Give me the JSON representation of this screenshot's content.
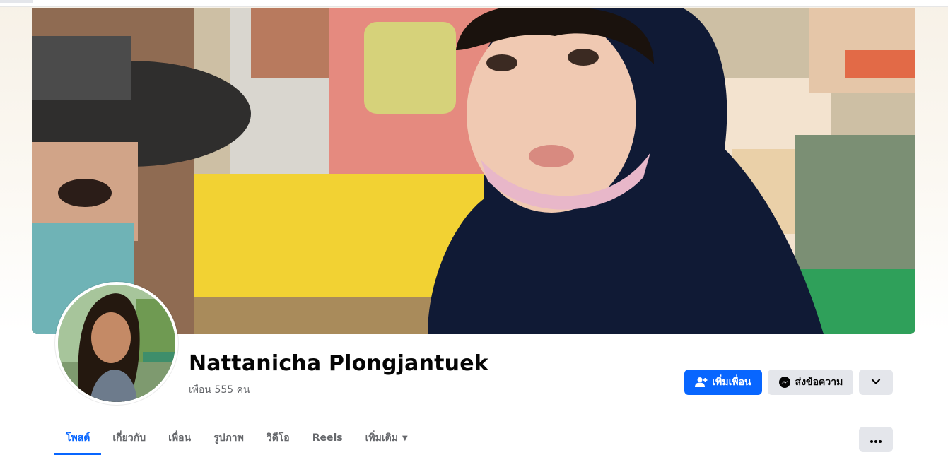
{
  "profile": {
    "name": "Nattanicha Plongjantuek",
    "friends_text": "เพื่อน 555 คน"
  },
  "actions": {
    "add_friend_label": "เพิ่มเพื่อน",
    "message_label": "ส่งข้อความ"
  },
  "tabs": [
    {
      "label": "โพสต์",
      "active": true
    },
    {
      "label": "เกี่ยวกับ",
      "active": false
    },
    {
      "label": "เพื่อน",
      "active": false
    },
    {
      "label": "รูปภาพ",
      "active": false
    },
    {
      "label": "วิดีโอ",
      "active": false
    },
    {
      "label": "Reels",
      "active": false
    },
    {
      "label": "เพิ่มเติม",
      "active": false
    }
  ],
  "icons": {
    "add_friend": "person-plus-icon",
    "message": "messenger-icon",
    "chevron": "chevron-down-icon",
    "more": "ellipsis-icon",
    "more_tab_caret": "caret-down-icon"
  },
  "colors": {
    "accent": "#0866ff",
    "secondary_button": "#e4e6eb",
    "text_primary": "#050505",
    "text_secondary": "#65676b"
  }
}
